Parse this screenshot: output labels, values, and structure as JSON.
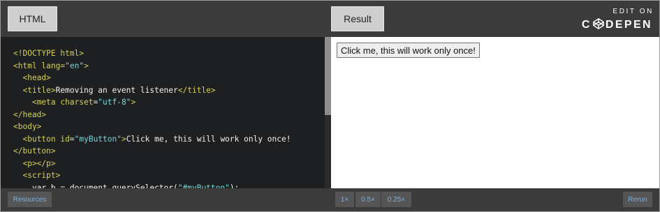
{
  "header": {
    "html_tab_label": "HTML",
    "result_tab_label": "Result",
    "edit_on": "EDIT ON",
    "codepen_part1": "C",
    "codepen_part2": "DEPEN"
  },
  "code_lines": [
    "<!DOCTYPE html>",
    "<html lang=\"en\">",
    "  <head>",
    "  <title>Removing an event listener</title>",
    "    <meta charset=\"utf-8\">",
    "</head>",
    "<body>",
    "  <button id=\"myButton\">Click me, this will work only once!",
    "</button>",
    "  <p></p>",
    "  <script>",
    "    var b = document.querySelector(\"#myButton\");"
  ],
  "result": {
    "button_label": "Click me, this will work only once!"
  },
  "footer": {
    "resources_label": "Resources",
    "zoom_1x": "1×",
    "zoom_05x": "0.5×",
    "zoom_025x": "0.25×",
    "rerun_label": "Rerun"
  },
  "colors": {
    "background_top": "#3b3b3b",
    "code_bg": "#1d1f20",
    "tag_yellow": "#d6d15a",
    "value_cyan": "#79d7da"
  }
}
